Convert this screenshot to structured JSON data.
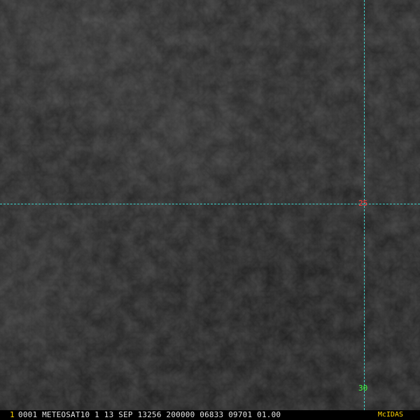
{
  "image": {
    "description_colors": {
      "background": "#232323",
      "grid_line": "#3fd3cc",
      "label_25": "#ff3a3a",
      "label_30": "#3cff3c",
      "status_frame": "#ffd400",
      "status_text": "#e6e6e6",
      "brand": "#ffd400"
    }
  },
  "grid": {
    "horizontal_label": "25",
    "vertical_label": "30"
  },
  "status_bar": {
    "frame_number": "1",
    "info": "0001 METEOSAT10 1 13 SEP 13256 200000 06833 09701 01.00",
    "brand": "McIDAS"
  }
}
